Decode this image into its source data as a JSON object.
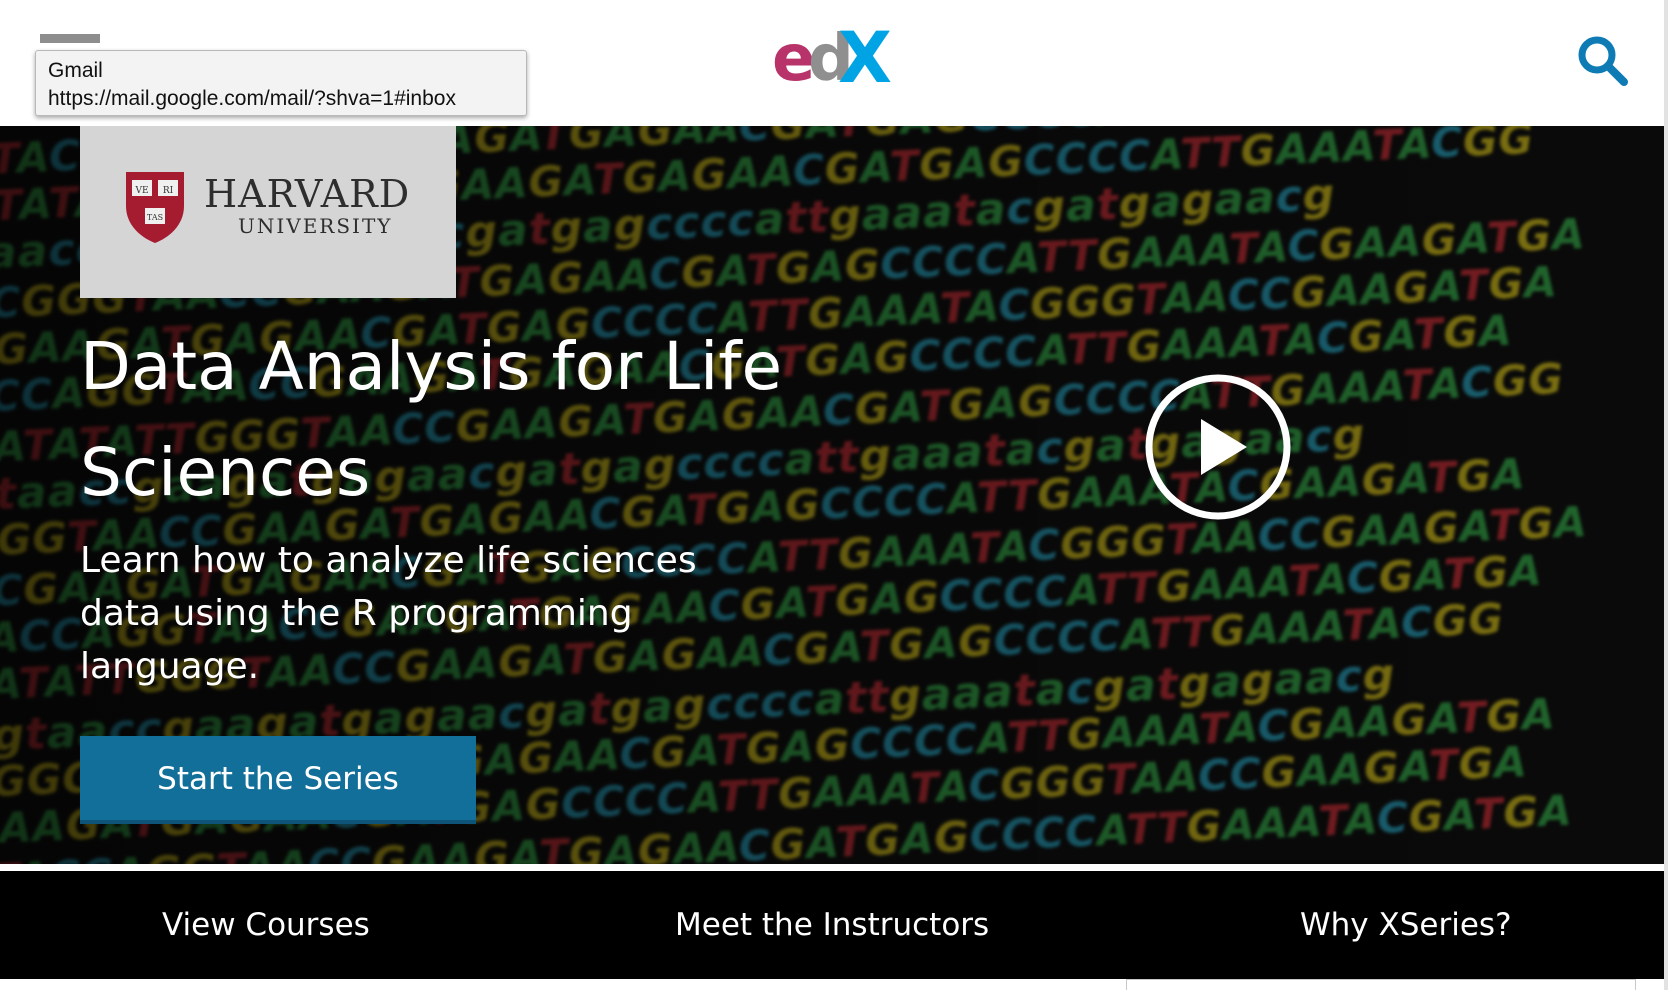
{
  "tooltip": {
    "title": "Gmail",
    "url": "https://mail.google.com/mail/?shva=1#inbox"
  },
  "header": {
    "logo_text": "edX",
    "logo_colors": {
      "e": "#b8336a",
      "d": "#8f8f8f",
      "X": "#00a4e4"
    },
    "menu_icon": "hamburger-menu-icon",
    "search_icon": "search-icon",
    "search_color": "#0e7bb4"
  },
  "hero": {
    "partner": {
      "name": "HARVARD",
      "subname": "UNIVERSITY",
      "shield_text": [
        "VE",
        "RI",
        "TAS"
      ]
    },
    "title": "Data Analysis for Life Sciences",
    "subtitle": "Learn how to analyze life sciences data using the R programming language.",
    "cta_label": "Start the Series",
    "cta_color": "#126f9a",
    "play_icon": "play-icon"
  },
  "nav": {
    "items": [
      {
        "label": "View Courses"
      },
      {
        "label": "Meet the Instructors"
      },
      {
        "label": "Why XSeries?"
      }
    ]
  }
}
